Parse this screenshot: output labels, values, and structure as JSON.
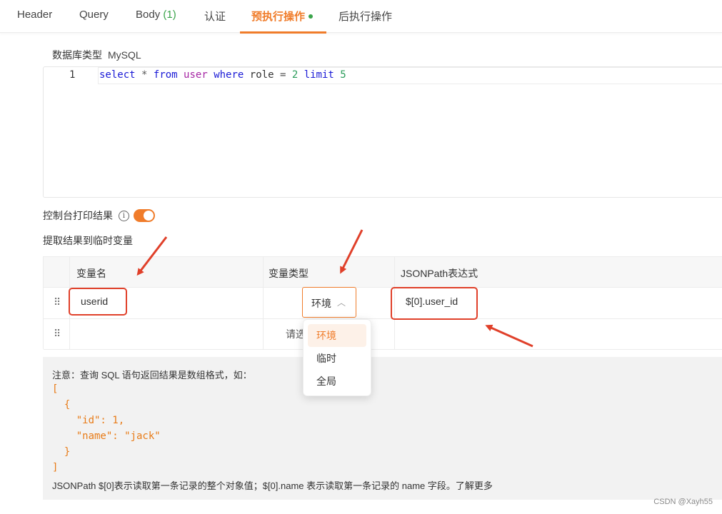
{
  "tabs": [
    {
      "label": "Header"
    },
    {
      "label": "Query"
    },
    {
      "label": "Body",
      "count": "(1)"
    },
    {
      "label": "认证"
    },
    {
      "label": "预执行操作"
    },
    {
      "label": "后执行操作"
    }
  ],
  "active_tab": "预执行操作",
  "db": {
    "label": "数据库类型",
    "value": "MySQL"
  },
  "editor": {
    "line_number": "1",
    "tokens": {
      "select": "select",
      "star": "*",
      "from": "from",
      "table": "user",
      "where": "where",
      "col": "role",
      "eq": "=",
      "num1": "2",
      "limit": "limit",
      "num2": "5"
    }
  },
  "console": {
    "label": "控制台打印结果",
    "info": "i",
    "enabled": true
  },
  "extract_label": "提取结果到临时变量",
  "table": {
    "headers": [
      "变量名",
      "变量类型",
      "JSONPath表达式"
    ],
    "row1": {
      "name": "userid",
      "type": "环境",
      "jsonpath": "$[0].user_id"
    },
    "row2": {
      "placeholder": "请选择"
    }
  },
  "dropdown": {
    "options": [
      "环境",
      "临时",
      "全局"
    ],
    "selected": "环境"
  },
  "notes": {
    "intro": "注意：查询 SQL 语句返回结果是数组格式，如：",
    "code_lines": [
      "[",
      "  {",
      "    \"id\": 1,",
      "    \"name\": \"jack\"",
      "  }",
      "]"
    ],
    "outro": "JSONPath $[0]表示读取第一条记录的整个对象值；$[0].name 表示读取第一条记录的 name 字段。了解更多"
  },
  "watermark": "CSDN @Xayh55",
  "colors": {
    "accent": "#f07c2a",
    "annotation_red": "#e0402a",
    "count_green": "#3aa44a"
  }
}
